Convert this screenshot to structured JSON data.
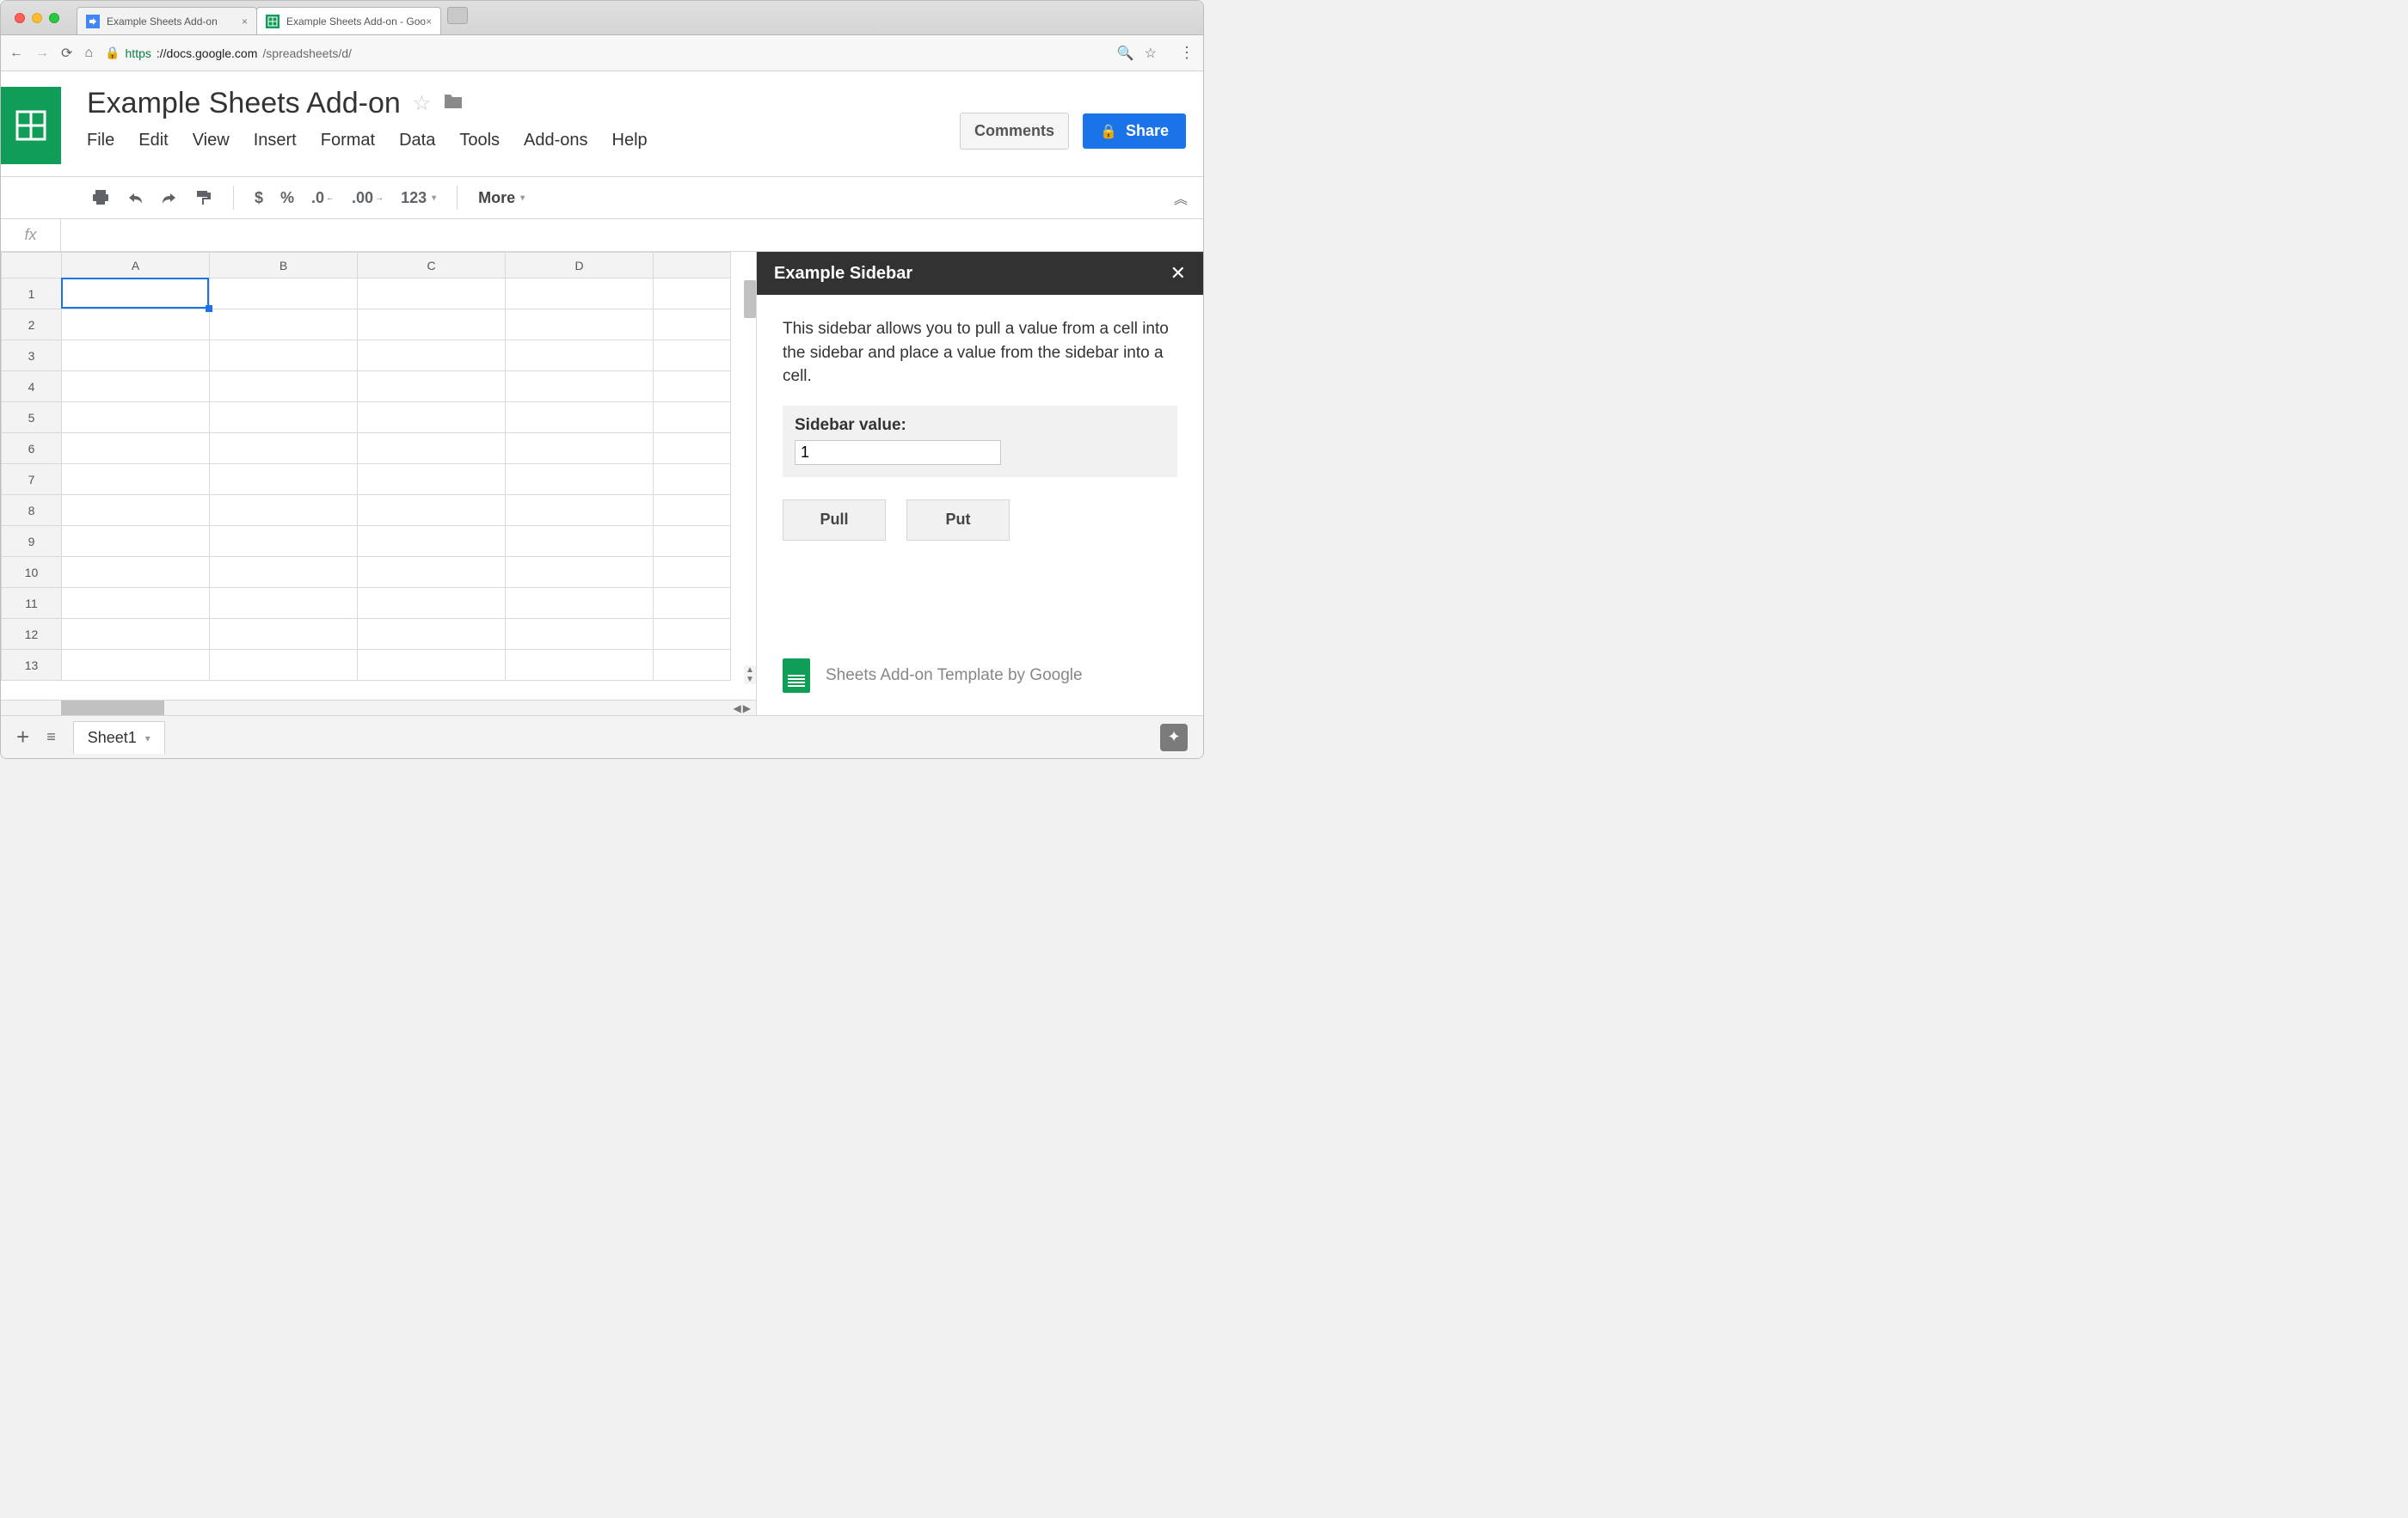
{
  "browser": {
    "tabs": [
      {
        "title": "Example Sheets Add-on",
        "active": false
      },
      {
        "title": "Example Sheets Add-on - Goo",
        "active": true
      }
    ],
    "url_https": "https",
    "url_host": "://docs.google.com",
    "url_path": "/spreadsheets/d/"
  },
  "doc": {
    "title": "Example Sheets Add-on",
    "menus": [
      "File",
      "Edit",
      "View",
      "Insert",
      "Format",
      "Data",
      "Tools",
      "Add-ons",
      "Help"
    ],
    "comments_label": "Comments",
    "share_label": "Share"
  },
  "toolbar": {
    "dollar": "$",
    "percent": "%",
    "dec_less": ".0",
    "dec_more": ".00",
    "numfmt": "123",
    "more": "More"
  },
  "formula_bar": {
    "label": "fx",
    "value": ""
  },
  "grid": {
    "columns": [
      "A",
      "B",
      "C",
      "D",
      ""
    ],
    "rows": [
      "1",
      "2",
      "3",
      "4",
      "5",
      "6",
      "7",
      "8",
      "9",
      "10",
      "11",
      "12",
      "13"
    ],
    "selected": "A1"
  },
  "sheetbar": {
    "tab": "Sheet1"
  },
  "sidebar": {
    "title": "Example Sidebar",
    "description": "This sidebar allows you to pull a value from a cell into the sidebar and place a value from the sidebar into a cell.",
    "field_label": "Sidebar value:",
    "field_value": "1",
    "pull_label": "Pull",
    "put_label": "Put",
    "footer": "Sheets Add-on Template by Google"
  }
}
